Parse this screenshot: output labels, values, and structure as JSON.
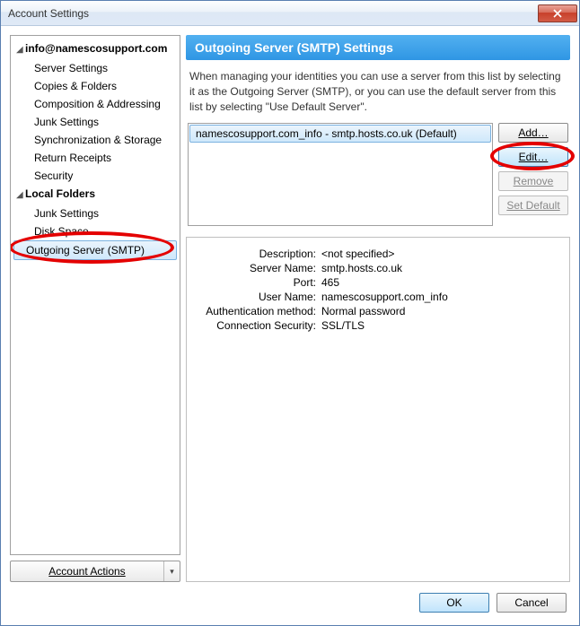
{
  "window": {
    "title": "Account Settings"
  },
  "tree": {
    "account": {
      "label": "info@namescosupport.com",
      "items": [
        "Server Settings",
        "Copies & Folders",
        "Composition & Addressing",
        "Junk Settings",
        "Synchronization & Storage",
        "Return Receipts",
        "Security"
      ]
    },
    "local": {
      "label": "Local Folders",
      "items": [
        "Junk Settings",
        "Disk Space"
      ]
    },
    "smtp": "Outgoing Server (SMTP)"
  },
  "account_actions": {
    "label": "Account Actions"
  },
  "heading": "Outgoing Server (SMTP) Settings",
  "description": "When managing your identities you can use a server from this list by selecting it as the Outgoing Server (SMTP), or you can use the default server from this list by selecting \"Use Default Server\".",
  "server_list": {
    "selected": "namescosupport.com_info - smtp.hosts.co.uk (Default)"
  },
  "buttons": {
    "add": "Add…",
    "edit": "Edit…",
    "remove": "Remove",
    "set_default": "Set Default"
  },
  "details": {
    "description_label": "Description:",
    "description_value": "<not specified>",
    "server_label": "Server Name:",
    "server_value": "smtp.hosts.co.uk",
    "port_label": "Port:",
    "port_value": "465",
    "user_label": "User Name:",
    "user_value": "namescosupport.com_info",
    "auth_label": "Authentication method:",
    "auth_value": "Normal password",
    "sec_label": "Connection Security:",
    "sec_value": "SSL/TLS"
  },
  "footer": {
    "ok": "OK",
    "cancel": "Cancel"
  }
}
